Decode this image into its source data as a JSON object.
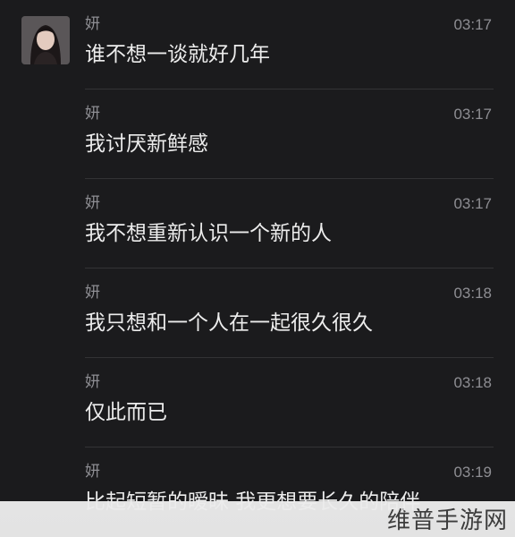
{
  "messages": [
    {
      "sender": "妍",
      "time": "03:17",
      "text": "谁不想一谈就好几年",
      "avatar": "avatar-photo"
    },
    {
      "sender": "妍",
      "time": "03:17",
      "text": "我讨厌新鲜感"
    },
    {
      "sender": "妍",
      "time": "03:17",
      "text": "我不想重新认识一个新的人"
    },
    {
      "sender": "妍",
      "time": "03:18",
      "text": "我只想和一个人在一起很久很久"
    },
    {
      "sender": "妍",
      "time": "03:18",
      "text": "仅此而已"
    },
    {
      "sender": "妍",
      "time": "03:19",
      "text": "比起短暂的暧昧 我更想要长久的陪伴"
    }
  ],
  "watermark": "维普手游网",
  "colors": {
    "background": "#1b1b1d",
    "meta_text": "#8e8e93",
    "message_text": "#ececec",
    "divider": "#333335"
  }
}
